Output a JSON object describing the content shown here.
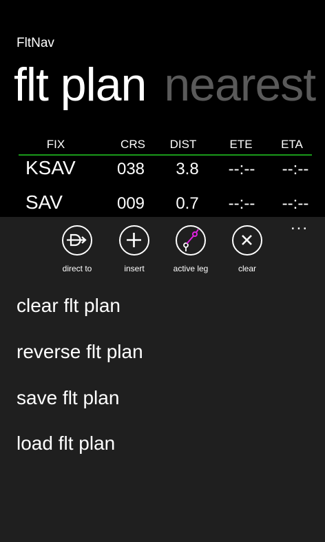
{
  "app": {
    "title": "FltNav"
  },
  "pivot": {
    "active": "flt plan",
    "next": "nearest"
  },
  "table": {
    "headers": [
      "FIX",
      "CRS",
      "DIST",
      "ETE",
      "ETA"
    ],
    "rows": [
      {
        "fix": "KSAV",
        "crs": "038",
        "dist": "3.8",
        "ete": "--:--",
        "eta": "--:--"
      },
      {
        "fix": "SAV",
        "crs": "009",
        "dist": "0.7",
        "ete": "--:--",
        "eta": "--:--"
      }
    ]
  },
  "appbar": {
    "more": "...",
    "buttons": [
      {
        "label": "direct to",
        "icon": "direct-to-icon"
      },
      {
        "label": "insert",
        "icon": "plus-icon"
      },
      {
        "label": "active leg",
        "icon": "active-leg-icon"
      },
      {
        "label": "clear",
        "icon": "close-icon"
      }
    ],
    "menu": [
      "clear flt plan",
      "reverse flt plan",
      "save flt plan",
      "load flt plan"
    ]
  },
  "colors": {
    "accent": "#1a9b1a",
    "active_leg": "#e020e0",
    "appbar_bg": "#1f1f1f",
    "inactive_pivot": "#5a5a5a"
  }
}
